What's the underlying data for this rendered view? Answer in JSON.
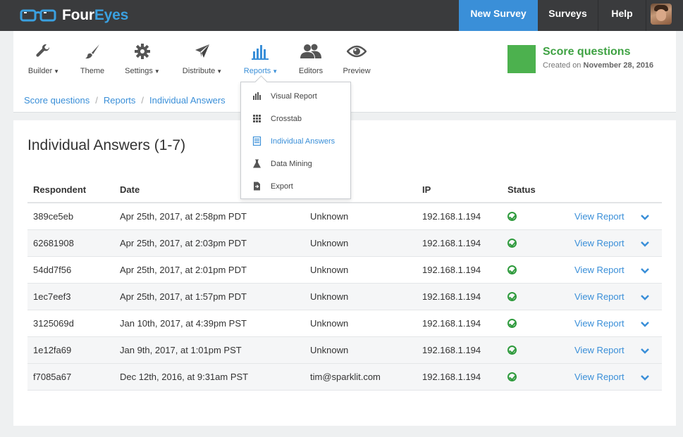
{
  "brand": {
    "four": "Four",
    "eyes": "Eyes"
  },
  "topnav": {
    "new_survey": "New Survey",
    "surveys": "Surveys",
    "help": "Help"
  },
  "toolbar": {
    "builder": "Builder",
    "theme": "Theme",
    "settings": "Settings",
    "distribute": "Distribute",
    "reports": "Reports",
    "editors": "Editors",
    "preview": "Preview"
  },
  "breadcrumb": [
    "Score questions",
    "Reports",
    "Individual Answers"
  ],
  "survey": {
    "name": "Score questions",
    "created_prefix": "Created on",
    "created_date": "November 28, 2016",
    "color": "#4cb14e"
  },
  "reports_menu": [
    "Visual Report",
    "Crosstab",
    "Individual Answers",
    "Data Mining",
    "Export"
  ],
  "page_title": "Individual Answers (1-7)",
  "table": {
    "headers": {
      "respondent": "Respondent",
      "date": "Date",
      "ip": "IP",
      "status": "Status"
    },
    "view_label": "View Report",
    "rows": [
      {
        "respondent": "389ce5eb",
        "date": "Apr 25th, 2017, at 2:58pm PDT",
        "email": "Unknown",
        "ip": "192.168.1.194"
      },
      {
        "respondent": "62681908",
        "date": "Apr 25th, 2017, at 2:03pm PDT",
        "email": "Unknown",
        "ip": "192.168.1.194"
      },
      {
        "respondent": "54dd7f56",
        "date": "Apr 25th, 2017, at 2:01pm PDT",
        "email": "Unknown",
        "ip": "192.168.1.194"
      },
      {
        "respondent": "1ec7eef3",
        "date": "Apr 25th, 2017, at 1:57pm PDT",
        "email": "Unknown",
        "ip": "192.168.1.194"
      },
      {
        "respondent": "3125069d",
        "date": "Jan 10th, 2017, at 4:39pm PST",
        "email": "Unknown",
        "ip": "192.168.1.194"
      },
      {
        "respondent": "1e12fa69",
        "date": "Jan 9th, 2017, at 1:01pm PST",
        "email": "Unknown",
        "ip": "192.168.1.194"
      },
      {
        "respondent": "f7085a67",
        "date": "Dec 12th, 2016, at 9:31am PST",
        "email": "tim@sparklit.com",
        "ip": "192.168.1.194"
      }
    ]
  },
  "colors": {
    "accent": "#3a8fd8",
    "topbar": "#3a3b3d",
    "success": "#2e9a3c"
  }
}
